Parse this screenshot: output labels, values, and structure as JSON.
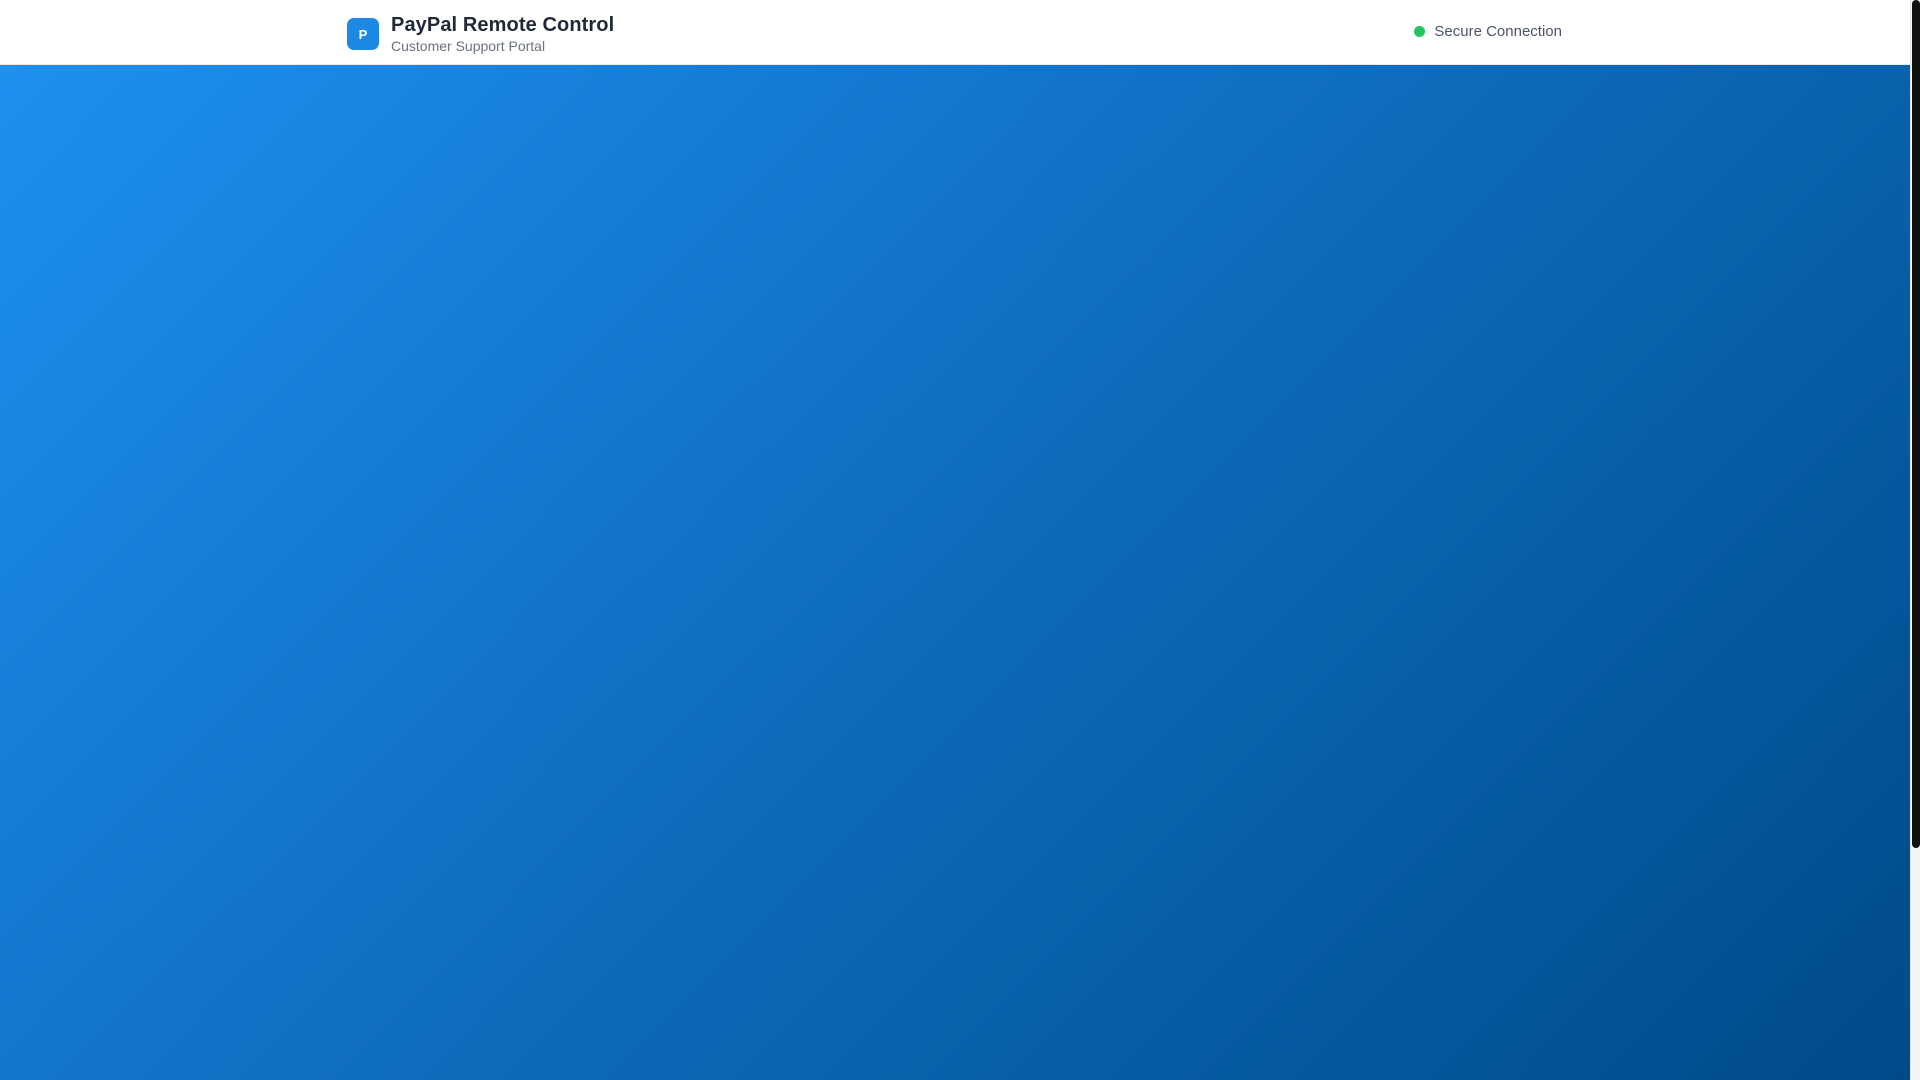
{
  "header": {
    "logo_letter": "P",
    "title": "PayPal Remote Control",
    "subtitle": "Customer Support Portal",
    "status_label": "Secure Connection"
  },
  "colors": {
    "brand_blue": "#1e88e5",
    "status_green": "#22c55e",
    "gradient_start": "#1e90ef",
    "gradient_end": "#004a88"
  },
  "icons": {
    "logo": "paypal-logo-badge",
    "status": "status-dot-icon"
  }
}
